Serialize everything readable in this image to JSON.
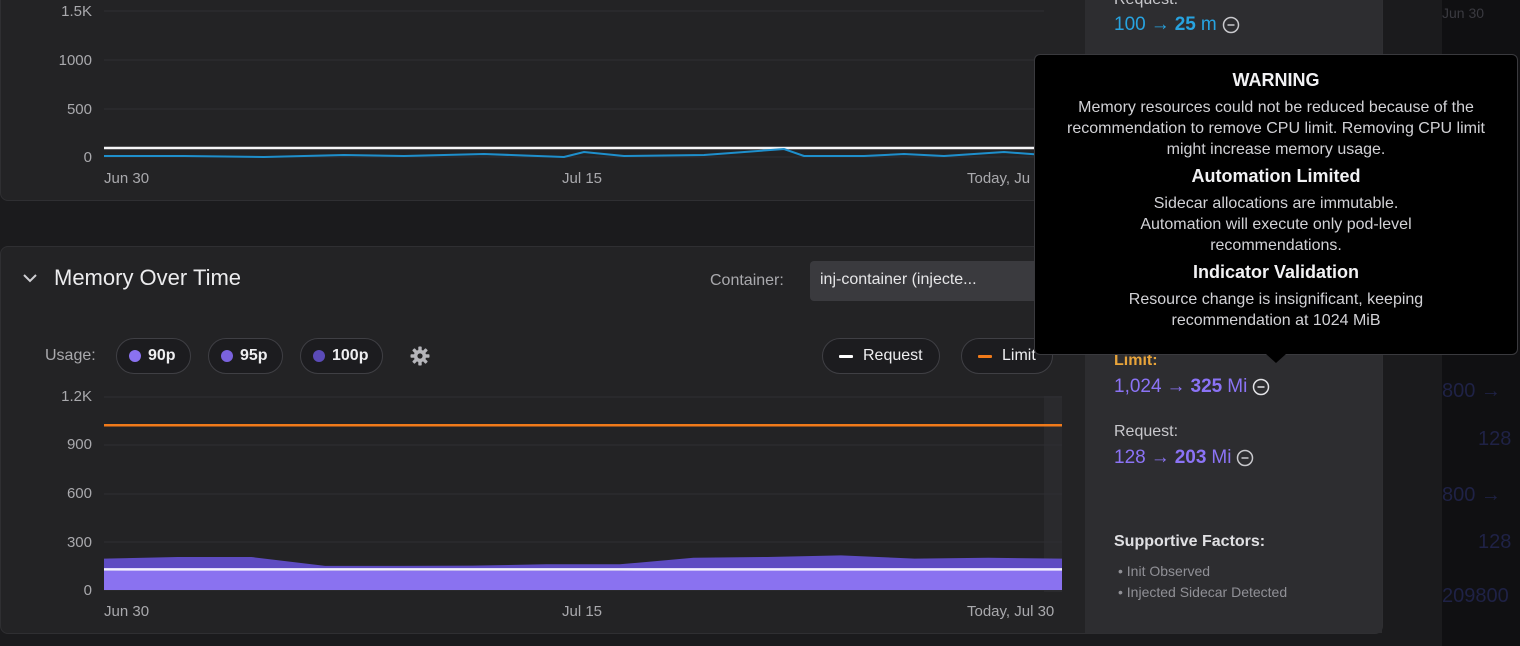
{
  "cpu": {
    "yticks": [
      "1.5K",
      "1000",
      "500",
      "0"
    ],
    "xticks": [
      "Jun 30",
      "Jul 15",
      "Today, Ju"
    ],
    "request_label": "Request:",
    "request_from": "100",
    "request_arrow": "→",
    "request_to": "25",
    "request_unit": "m"
  },
  "memory": {
    "title": "Memory Over Time",
    "container_label": "Container:",
    "container_value": "inj-container (injecte...",
    "usage_label": "Usage:",
    "usage_pills": [
      {
        "label": "90p",
        "color": "#8a72f0"
      },
      {
        "label": "95p",
        "color": "#7a62de"
      },
      {
        "label": "100p",
        "color": "#5b4bb8"
      }
    ],
    "legend": [
      {
        "label": "Request",
        "color": "#ffffff"
      },
      {
        "label": "Limit",
        "color": "#f07a1a"
      }
    ],
    "yticks": [
      "1.2K",
      "900",
      "600",
      "300",
      "0"
    ],
    "xticks": [
      "Jun 30",
      "Jul 15",
      "Today, Jul 30"
    ],
    "limit_label": "Limit:",
    "limit_from": "1,024",
    "limit_arrow": "→",
    "limit_to": "325",
    "limit_unit": "Mi",
    "request_label": "Request:",
    "request_from": "128",
    "request_arrow": "→",
    "request_to": "203",
    "request_unit": "Mi",
    "supportive_title": "Supportive Factors:",
    "factors": [
      "Init Observed",
      "Injected Sidecar Detected"
    ]
  },
  "chart_data": {
    "type": "area",
    "title": "Memory Over Time",
    "categories": [
      "Jun 30",
      "Jul 15",
      "Today, Jul 30"
    ],
    "ylim": [
      0,
      1200
    ],
    "series": [
      {
        "name": "100p",
        "values": [
          195,
          205,
          205,
          150,
          150,
          152,
          160,
          160,
          200,
          205,
          215,
          195,
          200,
          195
        ]
      },
      {
        "name": "90p",
        "values": [
          120,
          125,
          125,
          120,
          118,
          120,
          120,
          120,
          125,
          125,
          125,
          125,
          125,
          125
        ]
      },
      {
        "name": "Request",
        "values": [
          128,
          128,
          128,
          128,
          128,
          128,
          128,
          128,
          128,
          128,
          128,
          128,
          128,
          128
        ]
      },
      {
        "name": "Limit",
        "values": [
          1024,
          1024,
          1024,
          1024,
          1024,
          1024,
          1024,
          1024,
          1024,
          1024,
          1024,
          1024,
          1024,
          1024
        ]
      }
    ]
  },
  "tooltip": {
    "warning_title": "WARNING",
    "warning_text": "Memory resources could not be reduced because of the recommendation to remove CPU limit. Removing CPU limit might increase memory usage.",
    "automation_title": "Automation Limited",
    "automation_text_1": "Sidecar allocations are immutable.",
    "automation_text_2": "Automation will execute only pod-level recommendations.",
    "indicator_title": "Indicator Validation",
    "indicator_text": "Resource change is insignificant, keeping recommendation at 1024 MiB"
  },
  "far_right": {
    "top": "Jun 30",
    "a": "800 →",
    "b": "128",
    "c": "800 →",
    "d": "128",
    "e": "209800"
  },
  "colors": {
    "cpu_accent": "#27a3e0",
    "mem_accent": "#8b73f5",
    "limit_orange": "#f07a1a",
    "limit_label": "#e8a43a"
  }
}
